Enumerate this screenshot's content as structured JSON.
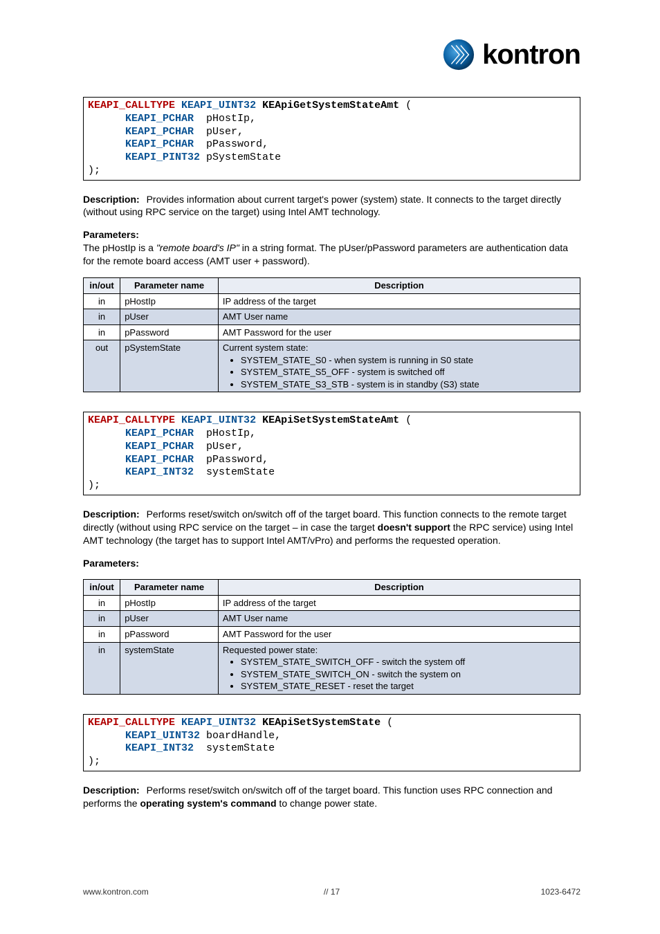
{
  "brand": {
    "name": "kontron"
  },
  "section": {
    "block1": {
      "code_html": "<span class='kw-red'>KEAPI_CALLTYPE</span> <span class='kw-blue'>KEAPI_UINT32</span> <span class='fn-name'>KEApiGetSystemStateAmt</span> (\n      <span class='kw-blue'>KEAPI_PCHAR</span>  pHostIp,\n      <span class='kw-blue'>KEAPI_PCHAR</span>  pUser,\n      <span class='kw-blue'>KEAPI_PCHAR</span>  pPassword,\n      <span class='kw-blue'>KEAPI_PINT32</span> pSystemState\n);",
      "desc_label": "Description:",
      "desc_text": "Provides information about current target's power (system) state. It connects to the target directly (without using RPC service on the target) using Intel AMT technology.",
      "param_label": "Parameters:",
      "param_sentence_pre": "The pHostIp is a ",
      "param_sentence_ital": "\"remote board's IP\"",
      "param_sentence_post": " in a string format. The pUser/pPassword parameters are authentication data for the remote board access (AMT user + password).",
      "table": {
        "headers": [
          "in/out",
          "Parameter name",
          "Description"
        ],
        "rows": [
          {
            "io": "in",
            "name": "pHostIp",
            "desc": "IP address of the target",
            "alt": false
          },
          {
            "io": "in",
            "name": "pUser",
            "desc": "AMT User name",
            "alt": true
          },
          {
            "io": "in",
            "name": "pPassword",
            "desc": "AMT Password for the user",
            "alt": false
          },
          {
            "io": "out",
            "name": "pSystemState",
            "desc_list": {
              "pre": "Current system state:",
              "items": [
                "SYSTEM_STATE_S0 - when system is running in S0 state",
                "SYSTEM_STATE_S5_OFF - system is switched off",
                "SYSTEM_STATE_S3_STB - system is in standby (S3) state"
              ]
            },
            "alt": true
          }
        ]
      }
    },
    "block2": {
      "code_html": "<span class='kw-red'>KEAPI_CALLTYPE</span> <span class='kw-blue'>KEAPI_UINT32</span> <span class='fn-name'>KEApiSetSystemStateAmt</span> (\n      <span class='kw-blue'>KEAPI_PCHAR</span>  pHostIp,\n      <span class='kw-blue'>KEAPI_PCHAR</span>  pUser,\n      <span class='kw-blue'>KEAPI_PCHAR</span>  pPassword,\n      <span class='kw-blue'>KEAPI_INT32</span>  systemState\n);",
      "desc_label": "Description:",
      "desc_text_pre": "Performs reset/switch on/switch off of the target board. This function connects to the remote target directly (without using RPC service on the target – in case the target ",
      "desc_bold": "doesn't support",
      "desc_text_post": " the RPC service) using Intel AMT technology (the target has to support Intel AMT/vPro) and performs the requested operation.",
      "param_label": "Parameters:",
      "table": {
        "headers": [
          "in/out",
          "Parameter name",
          "Description"
        ],
        "rows": [
          {
            "io": "in",
            "name": "pHostIp",
            "desc": "IP address of the target",
            "alt": false
          },
          {
            "io": "in",
            "name": "pUser",
            "desc": "AMT User name",
            "alt": true
          },
          {
            "io": "in",
            "name": "pPassword",
            "desc": "AMT Password for the user",
            "alt": false
          },
          {
            "io": "in",
            "name": "systemState",
            "desc_list": {
              "pre": "Requested power state:",
              "items": [
                "SYSTEM_STATE_SWITCH_OFF - switch the system off",
                "SYSTEM_STATE_SWITCH_ON - switch the system on",
                "SYSTEM_STATE_RESET - reset the target"
              ]
            },
            "alt": true
          }
        ]
      }
    },
    "block3": {
      "code_html": "<span class='kw-red'>KEAPI_CALLTYPE</span> <span class='kw-blue'>KEAPI_UINT32</span> <span class='fn-name'>KEApiSetSystemState</span> (\n      <span class='kw-blue'>KEAPI_UINT32</span> boardHandle,\n      <span class='kw-blue'>KEAPI_INT32</span>  systemState\n);",
      "desc_label": "Description:",
      "desc_text_pre": "Performs reset/switch on/switch off of the target board. This function uses RPC connection and performs the ",
      "desc_bold": "operating system's command",
      "desc_text_post": " to change power state."
    }
  },
  "footer": {
    "left": "www.kontron.com",
    "center": "// 17",
    "right": "1023-6472"
  }
}
